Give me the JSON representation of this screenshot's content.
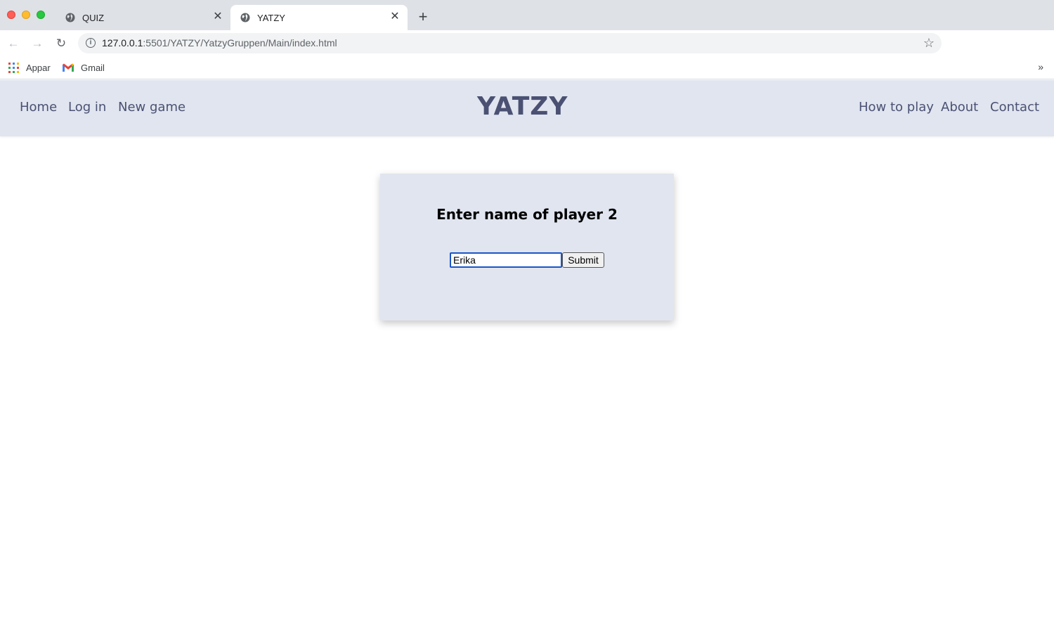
{
  "browser": {
    "tabs": [
      {
        "title": "QUIZ",
        "icon": "globe-icon",
        "active": false
      },
      {
        "title": "YATZY",
        "icon": "globe-icon",
        "active": true
      }
    ],
    "address_bar": {
      "host": "127.0.0.1",
      "path": ":5501/YATZY/YatzyGruppen/Main/index.html"
    },
    "bookmarks": [
      {
        "label": "Appar",
        "icon": "apps-grid-icon"
      },
      {
        "label": "Gmail",
        "icon": "gmail-icon"
      }
    ],
    "more_bookmarks": "»"
  },
  "site": {
    "title": "YATZY",
    "nav_left": [
      "Home",
      "Log in",
      "New game"
    ],
    "nav_right": [
      "How to play",
      "About",
      "Contact"
    ]
  },
  "form": {
    "heading": "Enter name of player 2",
    "name_value": "Erika",
    "submit_label": "Submit"
  },
  "colors": {
    "header_bg": "#e1e5ef",
    "nav_text": "#4a5173",
    "input_focus_border": "#1a56c9"
  }
}
